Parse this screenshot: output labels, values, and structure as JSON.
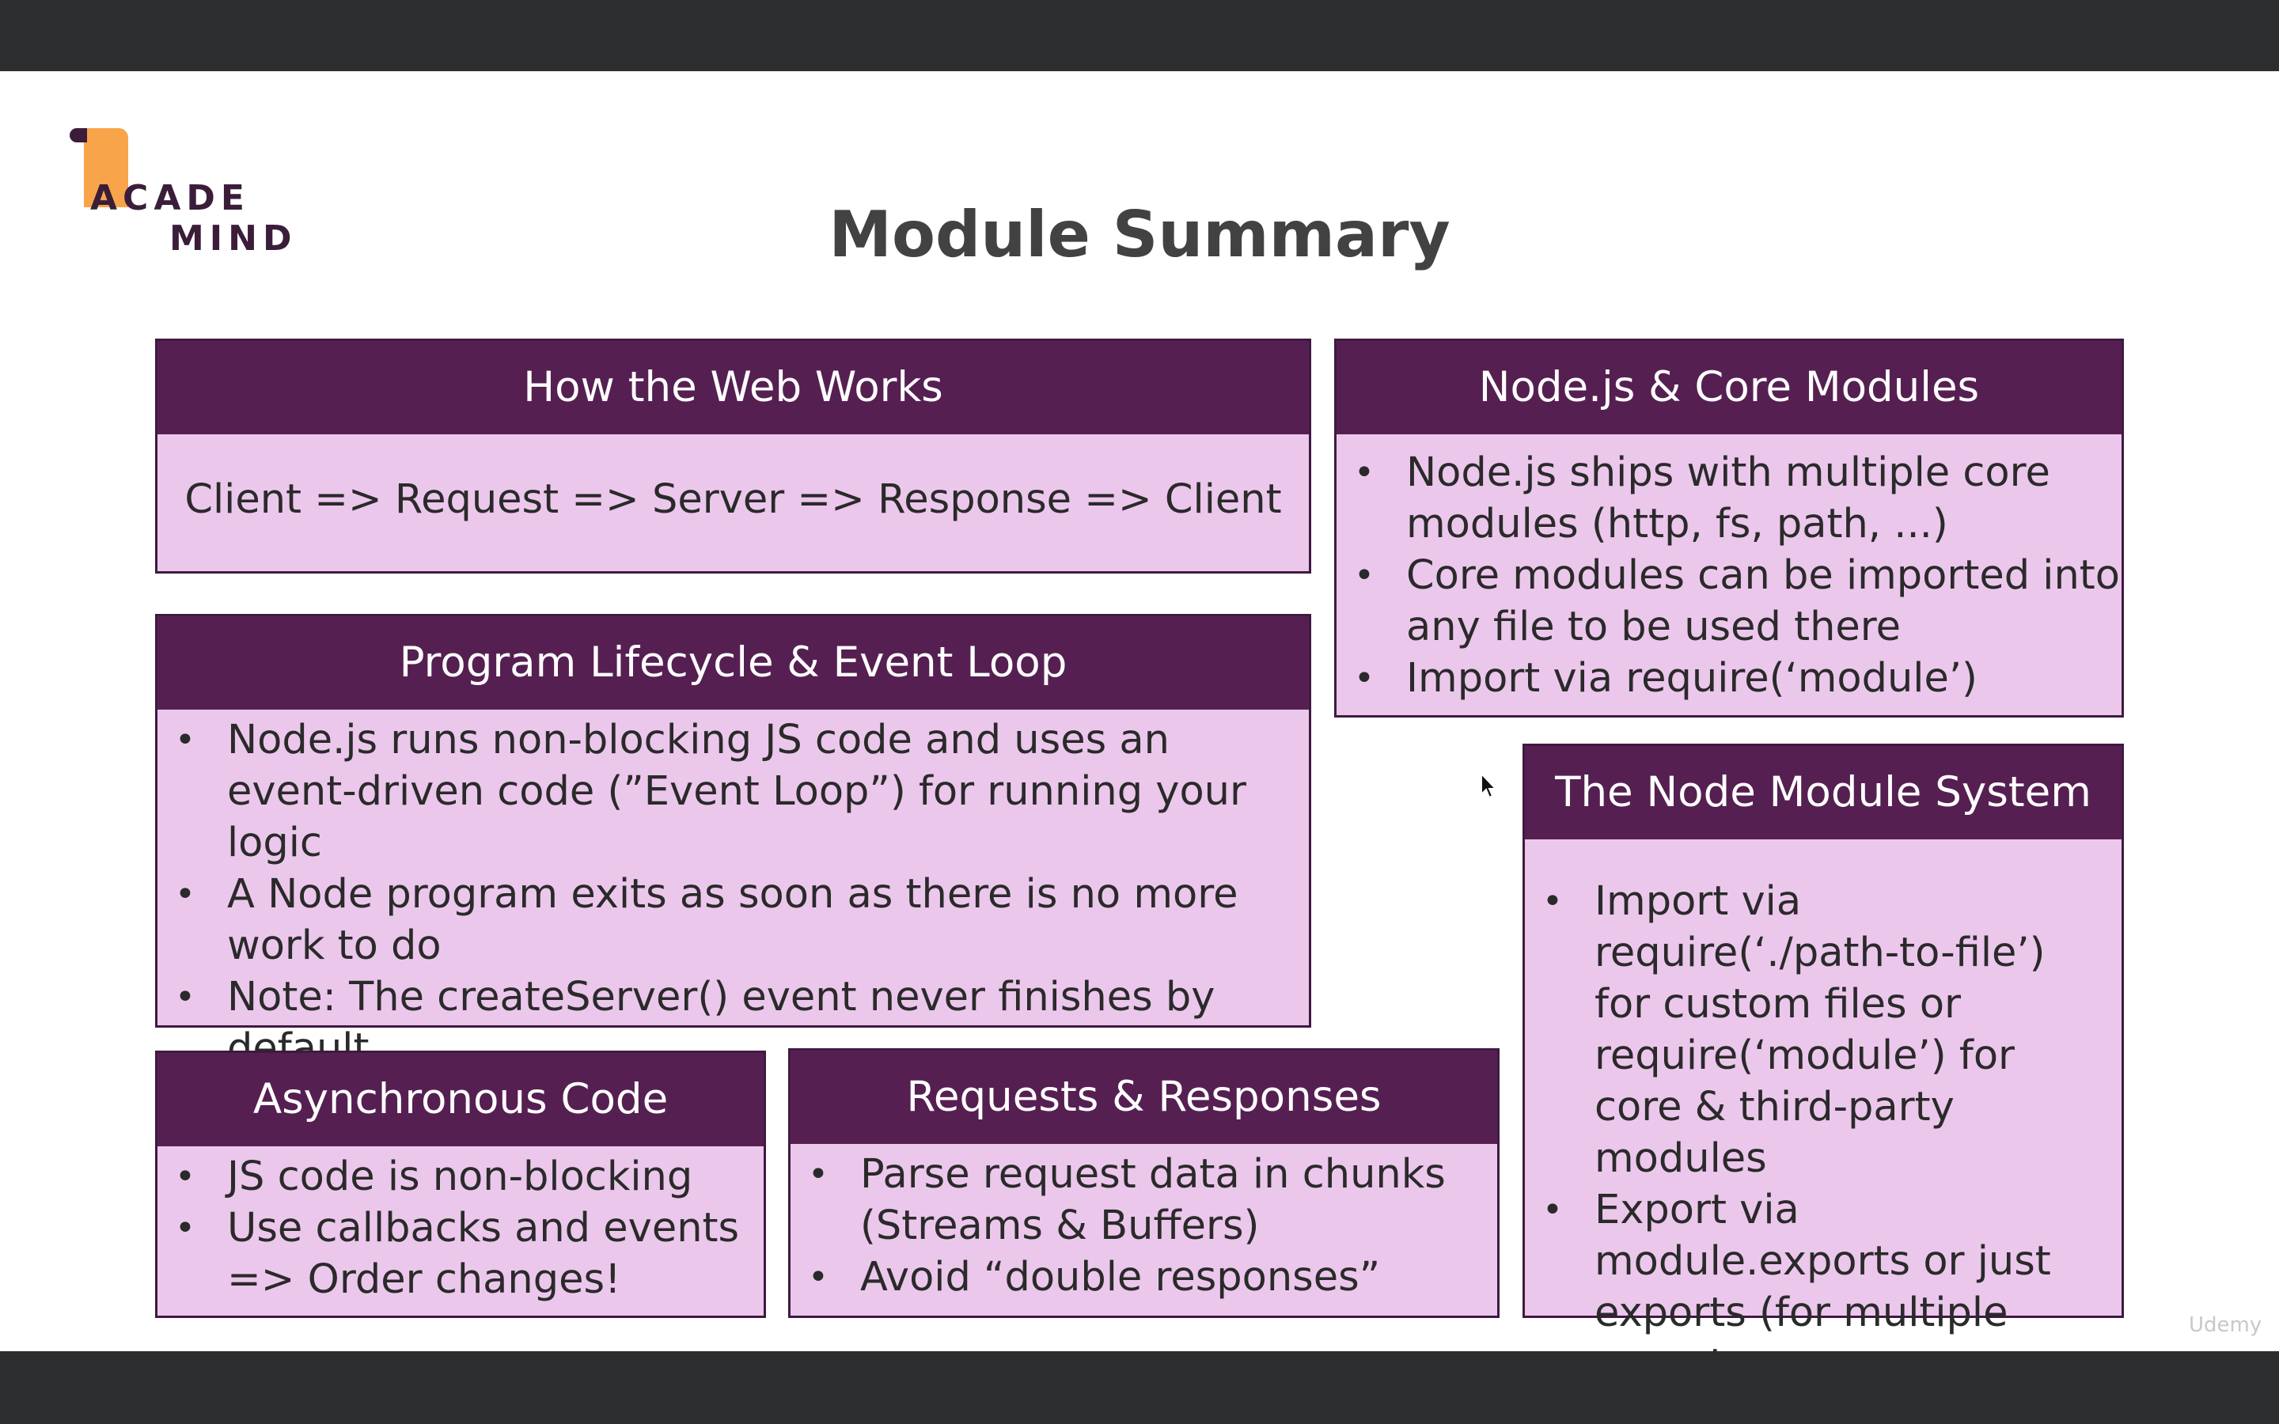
{
  "logo": {
    "line1": "ACADE",
    "line2": "MIND"
  },
  "title": "Module Summary",
  "cards": {
    "web": {
      "title": "How the Web Works",
      "text": "Client => Request => Server => Response => Client"
    },
    "core": {
      "title": "Node.js & Core Modules",
      "items": [
        "Node.js ships with multiple core modules (http, fs, path, ...)",
        "Core modules can be imported into any file to be used there",
        "Import via require(‘module’)"
      ]
    },
    "lifecycle": {
      "title": "Program Lifecycle & Event Loop",
      "items": [
        "Node.js runs non-blocking JS code and uses an event-driven code (”Event Loop”) for running your logic",
        "A Node program exits as soon as there is no more work to do",
        "Note: The createServer() event never finishes by default"
      ]
    },
    "nodemodule": {
      "title": "The Node Module System",
      "items": [
        "Import via require(‘./path-to-file’) for custom files or require(‘module’) for core & third-party modules",
        "Export via module.exports or just exports (for multiple exports"
      ]
    },
    "async": {
      "title": "Asynchronous Code",
      "items": [
        "JS code is non-blocking",
        "Use callbacks and events => Order changes!"
      ]
    },
    "requests": {
      "title": "Requests & Responses",
      "items": [
        "Parse request data in chunks (Streams & Buffers)",
        "Avoid “double responses”"
      ]
    }
  },
  "watermark": "Udemy",
  "colors": {
    "header": "#561f52",
    "card_body": "#ecc7ec",
    "logo_accent": "#f7a44a",
    "logo_text": "#3b1d3a"
  }
}
